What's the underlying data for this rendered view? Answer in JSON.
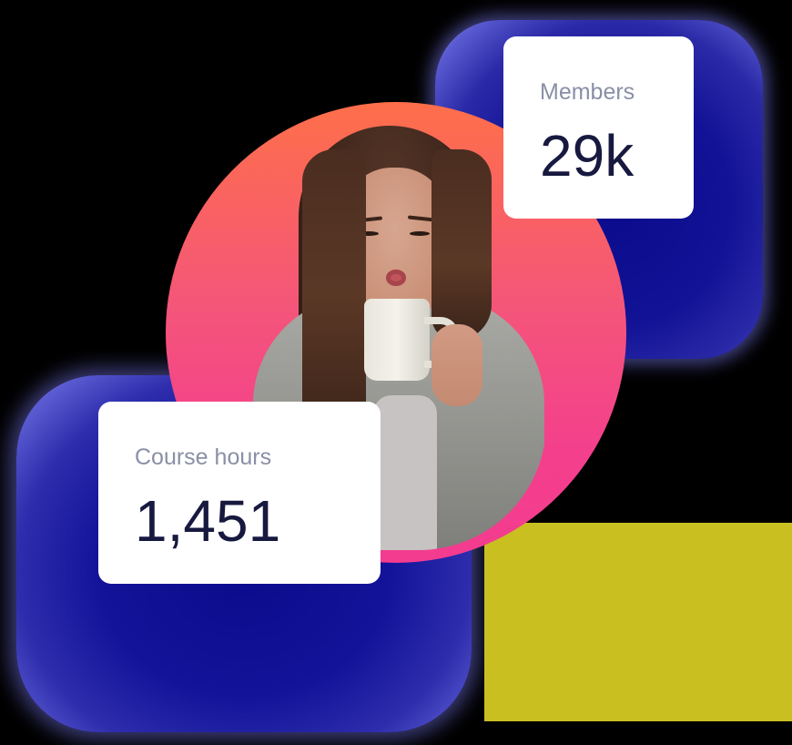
{
  "stats": {
    "members": {
      "label": "Members",
      "value": "29k"
    },
    "course_hours": {
      "label": "Course hours",
      "value": "1,451"
    }
  },
  "colors": {
    "background": "#000000",
    "glow": "#121296",
    "circle_gradient_top": "#ff6f4a",
    "circle_gradient_bottom": "#f33b8f",
    "card_background": "#ffffff",
    "label_text": "#8a8fa6",
    "value_text": "#17193f",
    "olive_block": "#c9bf21"
  }
}
